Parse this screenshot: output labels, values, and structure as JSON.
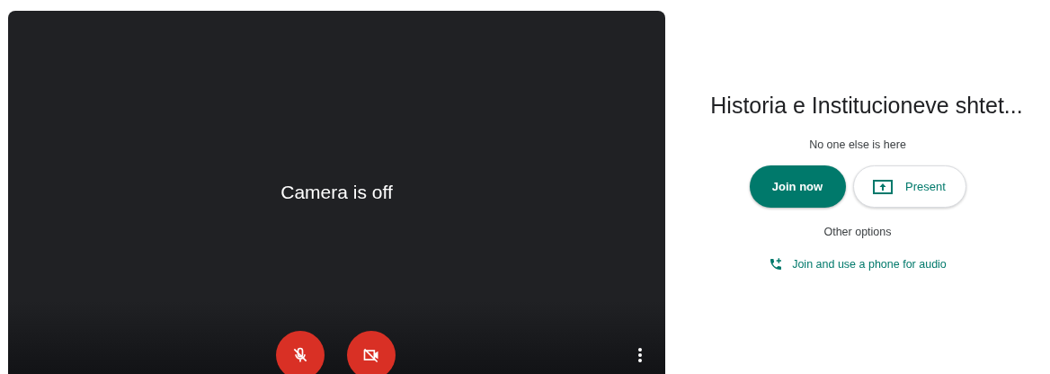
{
  "preview": {
    "camera_message": "Camera is off",
    "mic_on": false,
    "camera_on": false
  },
  "meeting": {
    "title": "Historia e Institucioneve shtet...",
    "status": "No one else is here"
  },
  "actions": {
    "join": "Join now",
    "present": "Present"
  },
  "other_options": {
    "label": "Other options",
    "phone_link": "Join and use a phone for audio"
  }
}
